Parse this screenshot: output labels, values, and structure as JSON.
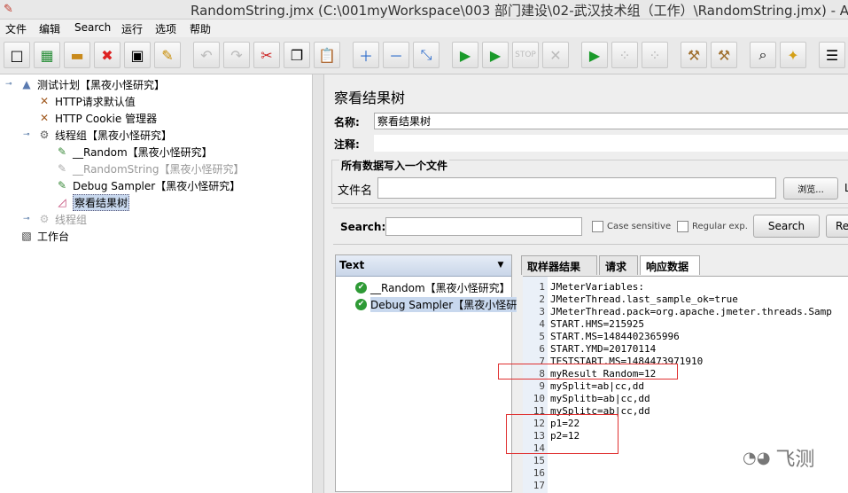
{
  "window": {
    "title": "RandomString.jmx (C:\\001myWorkspace\\003 部门建设\\02-武汉技术组（工作）\\RandomString.jmx) - Apa"
  },
  "menu": [
    "文件",
    "编辑",
    "Search",
    "运行",
    "选项",
    "帮助"
  ],
  "toolbar": {
    "buttons": [
      "new-icon",
      "templates-icon",
      "open-icon",
      "close-icon",
      "save-icon",
      "save-as-icon",
      "undo-icon",
      "redo-icon",
      "cut-icon",
      "copy-icon",
      "paste-icon",
      "expand-icon",
      "collapse-icon",
      "toggle-icon",
      "start-icon",
      "start-no-pause-icon",
      "stop-icon",
      "shutdown-icon",
      "remote-start-icon",
      "remote-stop-icon",
      "remote-shutdown-icon",
      "clear-icon",
      "clear-all-icon",
      "search-icon",
      "reset-search-icon",
      "function-helper-icon"
    ]
  },
  "tree": {
    "items": [
      {
        "label": "测试计划【黑夜小怪研究】",
        "icon": "test-plan-icon",
        "disabled": false,
        "selected": false
      },
      {
        "label": "HTTP请求默认值",
        "icon": "config-icon",
        "disabled": false,
        "selected": false
      },
      {
        "label": "HTTP Cookie 管理器",
        "icon": "config-icon",
        "disabled": false,
        "selected": false
      },
      {
        "label": "线程组【黑夜小怪研究】",
        "icon": "thread-group-icon",
        "disabled": false,
        "selected": false
      },
      {
        "label": "__Random【黑夜小怪研究】",
        "icon": "sampler-icon",
        "disabled": false,
        "selected": false
      },
      {
        "label": "__RandomString【黑夜小怪研究】",
        "icon": "sampler-icon",
        "disabled": true,
        "selected": false
      },
      {
        "label": "Debug Sampler【黑夜小怪研究】",
        "icon": "sampler-icon",
        "disabled": false,
        "selected": false
      },
      {
        "label": "察看结果树",
        "icon": "listener-icon",
        "disabled": false,
        "selected": true
      },
      {
        "label": "线程组",
        "icon": "thread-group-icon",
        "disabled": true,
        "selected": false
      },
      {
        "label": "工作台",
        "icon": "workbench-icon",
        "disabled": false,
        "selected": false
      }
    ]
  },
  "panel": {
    "title": "察看结果树",
    "name_label": "名称:",
    "name_value": "察看结果树",
    "comment_label": "注释:",
    "comment_value": "",
    "group_title": "所有数据写入一个文件",
    "filename_label": "文件名",
    "filename_value": "",
    "browse_label": "浏览...",
    "trailing_label": "L"
  },
  "search": {
    "label": "Search:",
    "value": "",
    "case_sensitive": "Case sensitive",
    "regular_exp": "Regular exp.",
    "search_button": "Search",
    "reset_button": "Re"
  },
  "results": {
    "renderer": "Text",
    "samples": [
      {
        "label": "__Random【黑夜小怪研究】",
        "status": "success"
      },
      {
        "label": "Debug Sampler【黑夜小怪研",
        "status": "success"
      }
    ],
    "tabs": [
      "取样器结果",
      "请求",
      "响应数据"
    ],
    "active_tab": "响应数据",
    "response_lines": [
      "JMeterVariables:",
      "JMeterThread.last_sample_ok=true",
      "JMeterThread.pack=org.apache.jmeter.threads.Samp",
      "START.HMS=215925",
      "START.MS=1484402365996",
      "START.YMD=20170114",
      "TESTSTART.MS=1484473971910",
      "myResult_Random=12",
      "mySplit=ab|cc,dd",
      "mySplitb=ab|cc,dd",
      "mySplitc=ab|cc,dd",
      "p1=22",
      "p2=12",
      "",
      "",
      "",
      ""
    ]
  },
  "watermark": {
    "text": "飞测"
  }
}
